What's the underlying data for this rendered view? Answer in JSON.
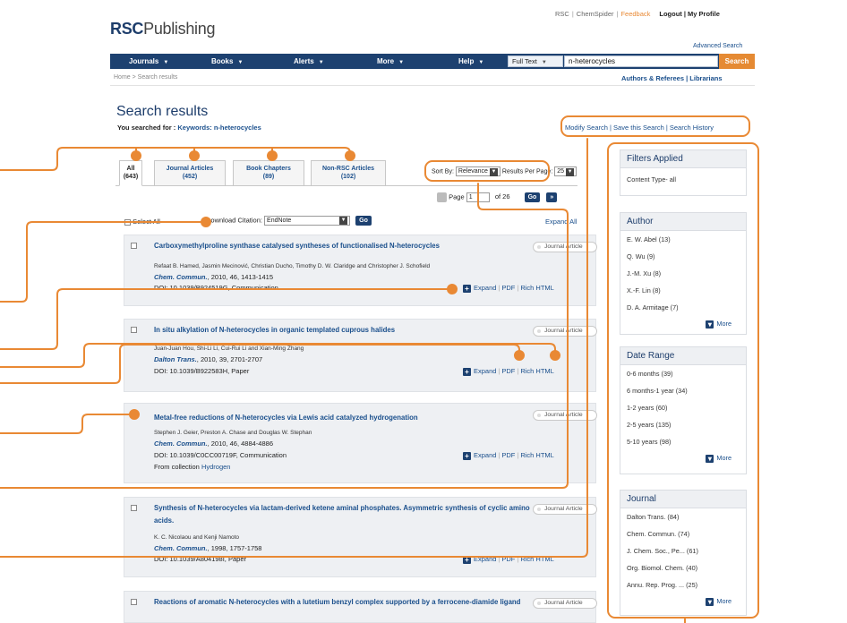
{
  "header": {
    "top_links": [
      "RSC",
      "ChemSpider",
      "Feedback"
    ],
    "logout_label": "Logout | My Profile",
    "logo_bold": "RSC",
    "logo_rest": "Publishing",
    "advanced_search": "Advanced Search"
  },
  "nav": {
    "items": [
      "Journals",
      "Books",
      "Alerts",
      "More",
      "Help"
    ],
    "field_select": "Full Text",
    "query": "n-heterocycles",
    "search_label": "Search"
  },
  "breadcrumb": "Home > Search results",
  "user_links": "Authors & Referees  |  Librarians",
  "page_title": "Search results",
  "searched_label": "You searched for :",
  "searched_value": "Keywords: n-heterocycles",
  "modify_links": "Modify Search | Save this Search | Search History",
  "tabs": [
    {
      "label": "All",
      "count": "(643)"
    },
    {
      "label": "Journal Articles",
      "count": "(452)"
    },
    {
      "label": "Book Chapters",
      "count": "(89)"
    },
    {
      "label": "Non-RSC Articles",
      "count": "(102)"
    }
  ],
  "sort": {
    "label": "Sort By:",
    "value": "Relevance",
    "per_page_label": "Results Per Page:",
    "per_page": "25"
  },
  "pager": {
    "page_label": "Page",
    "page": "1",
    "of_label": "of 26",
    "go": "Go",
    "next": "»"
  },
  "toolbar": {
    "select_all": "Select All",
    "download_label": "Download Citation:",
    "download_value": "EndNote",
    "go": "Go",
    "expand_all": "Expand All"
  },
  "results": [
    {
      "title": "Carboxymethylproline synthase catalysed syntheses of functionalised N-heterocycles",
      "authors": "Refaat B. Hamed, Jasmin Mecinović, Christian Ducho, Timothy D. W. Claridge and Christopher J. Schofield",
      "journal": "Chem. Commun.",
      "journal_rest": ", 2010, 46, 1413-1415",
      "doi": "DOI: 10.1039/B924519G, Communication",
      "badge": "Journal Article",
      "links": [
        "Expand",
        "PDF",
        "Rich HTML"
      ]
    },
    {
      "title": "In situ alkylation of N-heterocycles in organic templated cuprous halides",
      "authors": "Juan-Juan Hou, Shi-Li Li, Cui-Rui Li and Xian-Ming Zhang",
      "journal": "Dalton Trans.",
      "journal_rest": ", 2010, 39, 2701-2707",
      "doi": "DOI: 10.1039/B922583H, Paper",
      "badge": "Journal Article",
      "links": [
        "Expand",
        "PDF",
        "Rich HTML"
      ]
    },
    {
      "title": "Metal-free reductions of N-heterocycles via Lewis acid catalyzed hydrogenation",
      "authors": "Stephen J. Geier, Preston A. Chase and Douglas W. Stephan",
      "journal": "Chem. Commun.",
      "journal_rest": ", 2010, 46, 4884-4886",
      "doi": "DOI: 10.1039/C0CC00719F, Communication",
      "collection_label": "From collection",
      "collection": "Hydrogen",
      "badge": "Journal Article",
      "links": [
        "Expand",
        "PDF",
        "Rich HTML"
      ]
    },
    {
      "title": "Synthesis of N-heterocycles via lactam-derived ketene aminal phosphates. Asymmetric synthesis of cyclic amino acids.",
      "authors": "K. C. Nicolaou and Kenji Namoto",
      "journal": "Chem. Commun.",
      "journal_rest": ", 1998, 1757-1758",
      "doi": "DOI: 10.1039/A804198I, Paper",
      "badge": "Journal Article",
      "links": [
        "Expand",
        "PDF",
        "Rich HTML"
      ]
    },
    {
      "title": "Reactions of aromatic N-heterocycles with a lutetium benzyl complex supported by a ferrocene-diamide ligand",
      "badge": "Journal Article"
    }
  ],
  "sidebar": {
    "filters": {
      "title": "Filters Applied",
      "items": [
        "Content Type- all"
      ]
    },
    "author": {
      "title": "Author",
      "items": [
        "E. W. Abel (13)",
        "Q. Wu (9)",
        "J.-M. Xu (8)",
        "X.-F. Lin (8)",
        "D. A. Armitage (7)"
      ],
      "more": "More"
    },
    "date": {
      "title": "Date Range",
      "items": [
        "0-6 months (39)",
        "6 months-1 year (34)",
        "1-2 years (60)",
        "2-5 years (135)",
        "5-10 years (98)"
      ],
      "more": "More"
    },
    "journal": {
      "title": "Journal",
      "items": [
        "Dalton Trans. (84)",
        "Chem. Commun. (74)",
        "J. Chem. Soc., Pe... (61)",
        "Org. Biomol. Chem. (40)",
        "Annu. Rep. Prog. ... (25)"
      ],
      "more": "More"
    }
  },
  "colors": {
    "nav": "#1d4170",
    "accent": "#e58a33",
    "link": "#1a4f8c",
    "annotation": "#e98934"
  }
}
